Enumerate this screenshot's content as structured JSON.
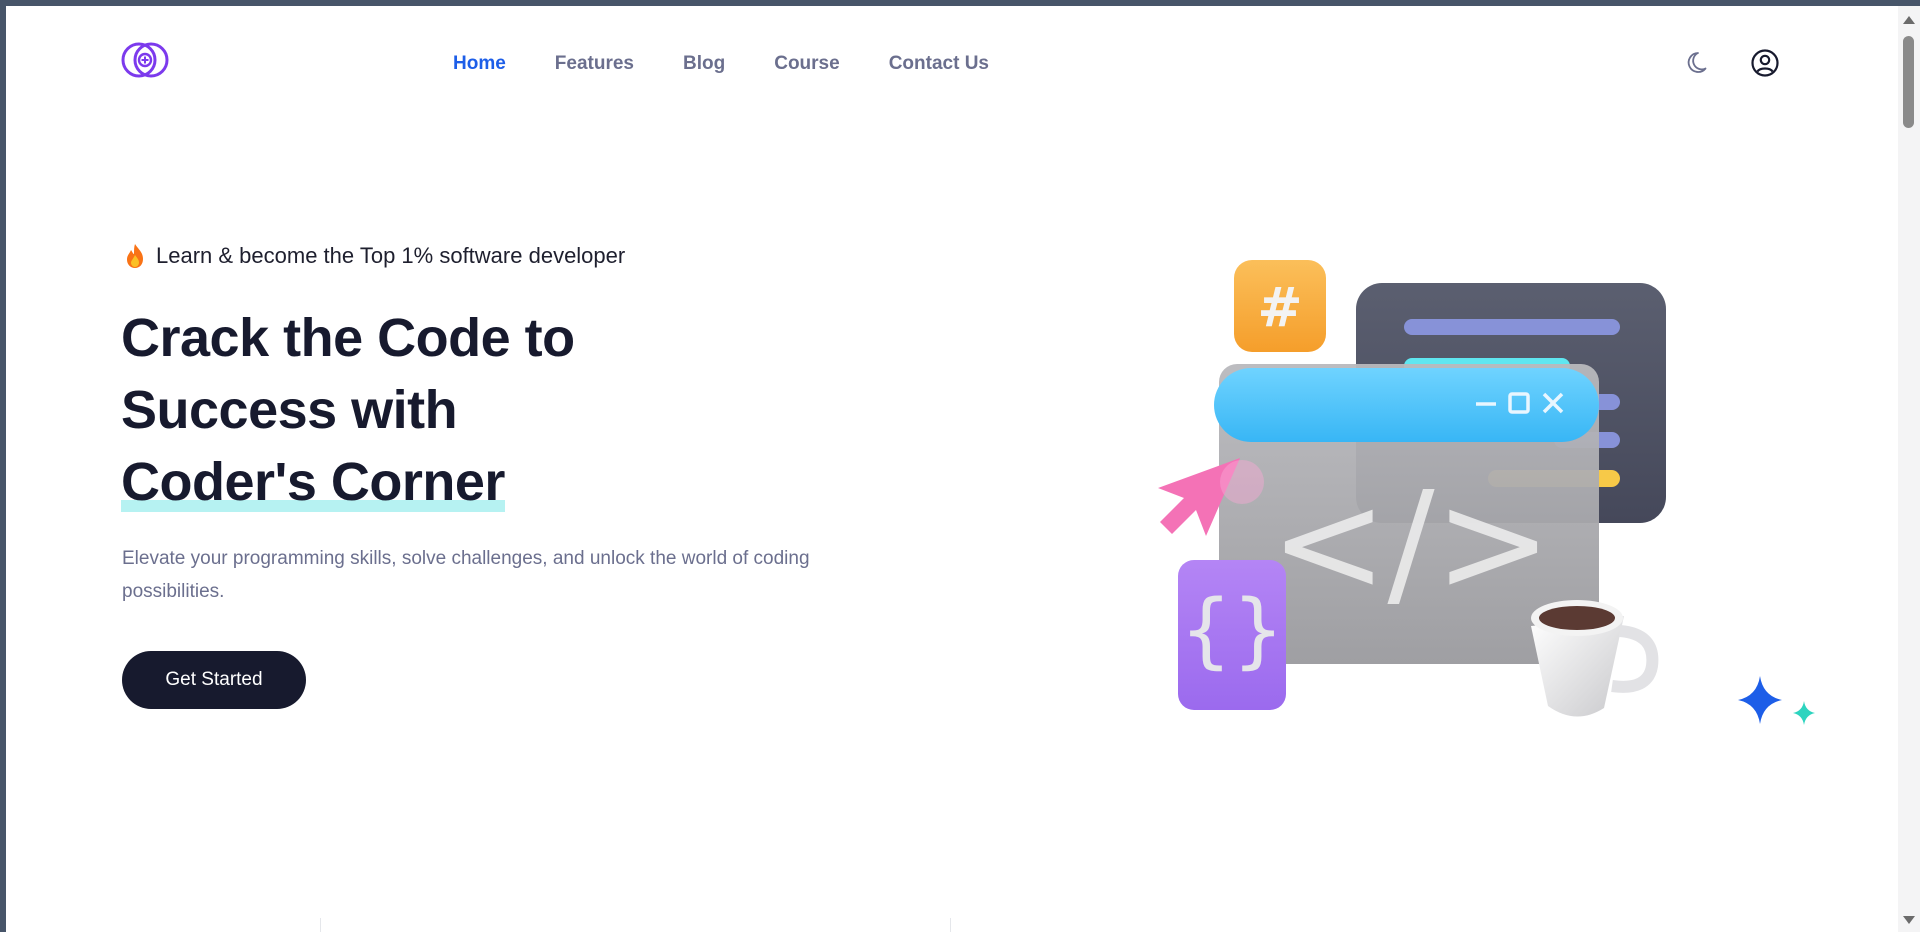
{
  "nav": {
    "items": [
      {
        "label": "Home",
        "active": true
      },
      {
        "label": "Features",
        "active": false
      },
      {
        "label": "Blog",
        "active": false
      },
      {
        "label": "Course",
        "active": false
      },
      {
        "label": "Contact Us",
        "active": false
      }
    ]
  },
  "header": {
    "theme_icon": "moon-icon",
    "profile_icon": "user-circle-icon"
  },
  "hero": {
    "tagline_icon": "fire-icon",
    "tagline": "Learn & become the Top 1% software developer",
    "title_line1": "Crack the Code to",
    "title_line2": "Success with",
    "title_line3": "Coder's Corner",
    "description": "Elevate your programming skills, solve challenges, and unlock the world of coding possibilities.",
    "cta_label": "Get Started",
    "illustration_labels": {
      "hash": "#",
      "braces": "{}",
      "code": "</>"
    }
  },
  "colors": {
    "accent": "#1d5ee8",
    "dark": "#171a2e",
    "muted_text": "#6b6f8e",
    "highlight": "#b6f2f2",
    "logo": "#7c3aed"
  }
}
